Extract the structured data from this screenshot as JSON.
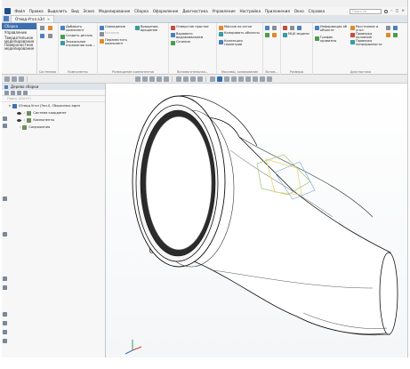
{
  "menu": {
    "items": [
      "Файл",
      "Правка",
      "Выделить",
      "Вид",
      "Эскиз",
      "Моделирование",
      "Сборка",
      "Оформление",
      "Диагностика",
      "Управление",
      "Настройка",
      "Приложения",
      "Окно",
      "Справка"
    ],
    "search_placeholder": "Поиск по"
  },
  "document_tab": {
    "title": "Отвод-Угол.a3d"
  },
  "ribbon": {
    "modes": [
      "Сборка",
      "Управление",
      "Твердотельное моделирование",
      "Поверхностное моделирование"
    ],
    "groups": [
      {
        "label": "Системная",
        "items": []
      },
      {
        "label": "Компоненты",
        "items": [
          "Добавить компонент",
          "Создать деталь",
          "Зеркальное отражение ком..."
        ]
      },
      {
        "label": "Размещение компонентов",
        "items": [
          "Совпадение",
          "Касание",
          "Переместить компонент",
          "Вращение-вращение"
        ]
      },
      {
        "label": "Вспомогательная...",
        "items": [
          "Отверстие простое",
          "Выдавить выдавливанием",
          "Сечение"
        ]
      },
      {
        "label": "Массивы, копирование",
        "items": [
          "Массив по сетке",
          "Копировать объекты",
          "Коллекция геометрии"
        ]
      },
      {
        "label": "Вспом...",
        "items": []
      },
      {
        "label": "Размеры",
        "items": [
          "MЦХ модели"
        ]
      },
      {
        "label": "Диагностика",
        "items": [
          "Информация об объекте",
          "График кривизны",
          "Расстояние и угол",
          "Проверка коллизий",
          "Проверка непрерывности"
        ]
      }
    ]
  },
  "tree_panel": {
    "title": "Дерево сборки",
    "filter_placeholder": "Поиск (Ctrl+F)",
    "nodes": [
      {
        "label": "(Отвод-Угол (Экз.0, Сборочных един",
        "kind": "root"
      },
      {
        "label": "Система координат",
        "kind": "child"
      },
      {
        "label": "Компоненты",
        "kind": "child"
      },
      {
        "label": "Сопряжения",
        "kind": "child"
      }
    ]
  },
  "colors": {
    "active_mode": "#3d6eb0",
    "panel_header": "#dfe4ea",
    "model_outline": "#111111",
    "sketch_green": "#9bc46a",
    "sketch_yellow": "#e6d36a",
    "sketch_blue": "#6fa0d8"
  },
  "icons": [
    "logo-icon",
    "search-icon",
    "doc-icon",
    "eye-icon",
    "expand-icon",
    "tree-node-icon",
    "filter-icon",
    "axis-triad-icon"
  ]
}
